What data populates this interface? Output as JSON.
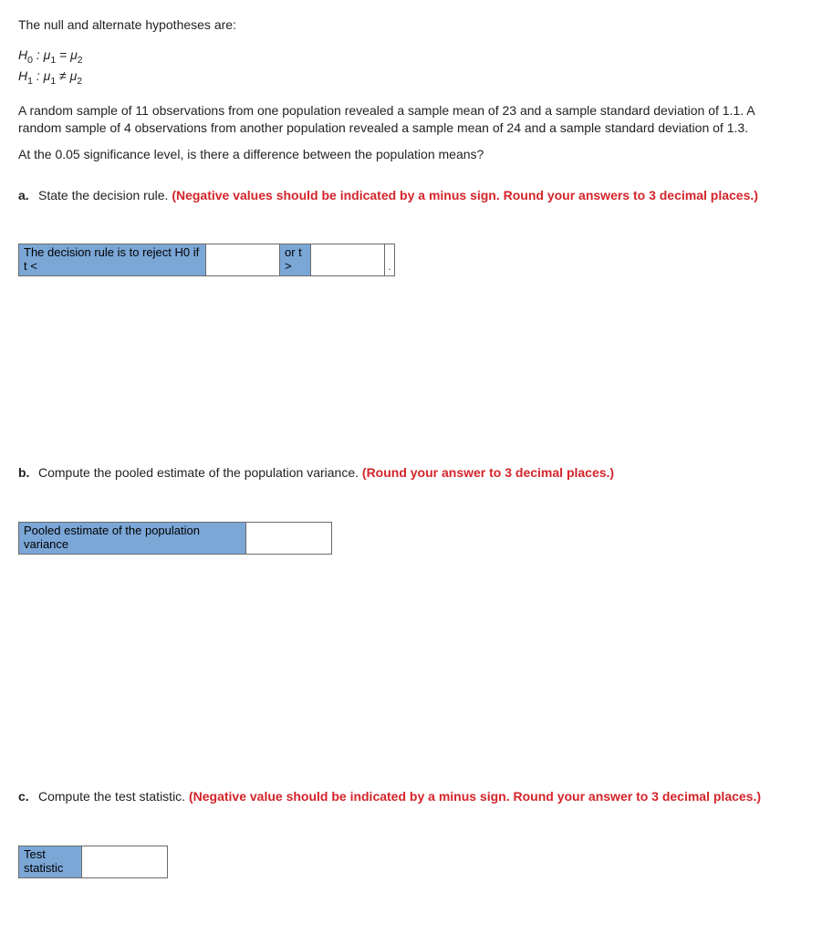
{
  "intro": "The null and alternate hypotheses are:",
  "hypotheses": {
    "h0_prefix": "H",
    "h0_sub": "0",
    "h0_rest": " : μ",
    "mu1_sub": "1",
    "eq": " = μ",
    "mu2_sub": "2",
    "h1_prefix": "H",
    "h1_sub": "1",
    "h1_rest": " : μ",
    "neq": " ≠ μ"
  },
  "problem_p1": "A random sample of 11 observations from one population revealed a sample mean of 23 and a sample standard deviation of 1.1. A random sample of 4 observations from another population revealed a sample mean of 24 and a sample standard deviation of 1.3.",
  "problem_p2": "At the 0.05 significance level, is there a difference between the population means?",
  "qa": {
    "letter": "a.",
    "prompt": "State the decision rule. ",
    "instr": "(Negative values should be indicated by a minus sign. Round your answers to 3 decimal places.)",
    "label1": "The decision rule is to reject H0 if t <",
    "label2": "or t >",
    "period": "."
  },
  "qb": {
    "letter": "b.",
    "prompt": "Compute the pooled estimate of the population variance. ",
    "instr": "(Round your answer to 3 decimal places.)",
    "label": "Pooled estimate of the population variance"
  },
  "qc": {
    "letter": "c.",
    "prompt": "Compute the test statistic. ",
    "instr": "(Negative value should be indicated by a minus sign. Round your answer to 3 decimal places.)",
    "label": "Test statistic"
  }
}
